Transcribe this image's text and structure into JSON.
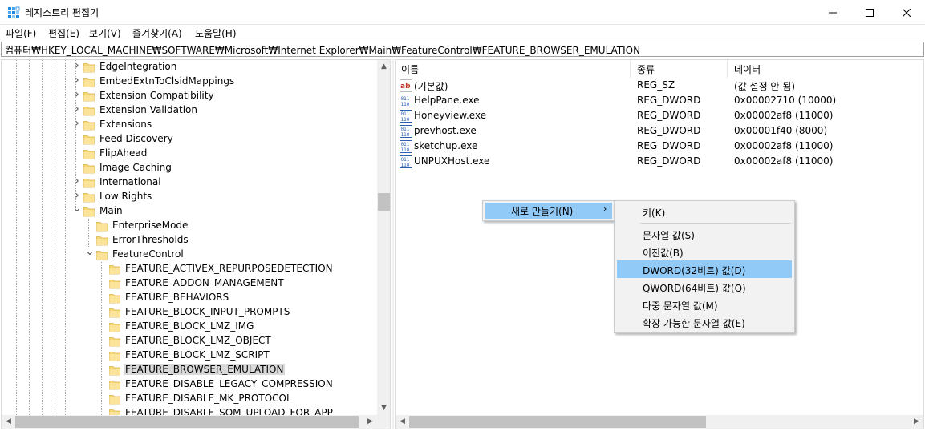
{
  "window": {
    "title": "레지스트리 편집기",
    "accent": "#1a73e8"
  },
  "menubar": {
    "items": [
      "파일(F)",
      "편집(E)",
      "보기(V)",
      "즐겨찾기(A)",
      "도움말(H)"
    ]
  },
  "address": "컴퓨터₩HKEY_LOCAL_MACHINE₩SOFTWARE₩Microsoft₩Internet Explorer₩Main₩FeatureControl₩FEATURE_BROWSER_EMULATION",
  "tree": {
    "items": [
      {
        "label": "EdgeIntegration",
        "expander": "collapsed"
      },
      {
        "label": "EmbedExtnToClsidMappings",
        "expander": "collapsed"
      },
      {
        "label": "Extension Compatibility",
        "expander": "collapsed"
      },
      {
        "label": "Extension Validation",
        "expander": "collapsed"
      },
      {
        "label": "Extensions",
        "expander": "collapsed"
      },
      {
        "label": "Feed Discovery",
        "expander": "none"
      },
      {
        "label": "FlipAhead",
        "expander": "none"
      },
      {
        "label": "Image Caching",
        "expander": "none"
      },
      {
        "label": "International",
        "expander": "collapsed"
      },
      {
        "label": "Low Rights",
        "expander": "collapsed"
      },
      {
        "label": "Main",
        "expander": "expanded"
      },
      {
        "label": "EnterpriseMode",
        "expander": "none"
      },
      {
        "label": "ErrorThresholds",
        "expander": "none"
      },
      {
        "label": "FeatureControl",
        "expander": "expanded"
      },
      {
        "label": "FEATURE_ACTIVEX_REPURPOSEDETECTION",
        "expander": "none"
      },
      {
        "label": "FEATURE_ADDON_MANAGEMENT",
        "expander": "none"
      },
      {
        "label": "FEATURE_BEHAVIORS",
        "expander": "none"
      },
      {
        "label": "FEATURE_BLOCK_INPUT_PROMPTS",
        "expander": "none"
      },
      {
        "label": "FEATURE_BLOCK_LMZ_IMG",
        "expander": "none"
      },
      {
        "label": "FEATURE_BLOCK_LMZ_OBJECT",
        "expander": "none"
      },
      {
        "label": "FEATURE_BLOCK_LMZ_SCRIPT",
        "expander": "none"
      },
      {
        "label": "FEATURE_BROWSER_EMULATION",
        "expander": "none",
        "selected": true
      },
      {
        "label": "FEATURE_DISABLE_LEGACY_COMPRESSION",
        "expander": "none"
      },
      {
        "label": "FEATURE_DISABLE_MK_PROTOCOL",
        "expander": "none"
      },
      {
        "label": "FEATURE_DISABLE_SQM_UPLOAD_FOR_APP",
        "expander": "none"
      }
    ]
  },
  "list": {
    "columns": [
      "이름",
      "종류",
      "데이터"
    ],
    "rows": [
      {
        "icon": "string-value-icon",
        "name": "(기본값)",
        "type": "REG_SZ",
        "data": "(값 설정 안 됨)"
      },
      {
        "icon": "binary-value-icon",
        "name": "HelpPane.exe",
        "type": "REG_DWORD",
        "data": "0x00002710 (10000)"
      },
      {
        "icon": "binary-value-icon",
        "name": "Honeyview.exe",
        "type": "REG_DWORD",
        "data": "0x00002af8 (11000)"
      },
      {
        "icon": "binary-value-icon",
        "name": "prevhost.exe",
        "type": "REG_DWORD",
        "data": "0x00001f40 (8000)"
      },
      {
        "icon": "binary-value-icon",
        "name": "sketchup.exe",
        "type": "REG_DWORD",
        "data": "0x00002af8 (11000)"
      },
      {
        "icon": "binary-value-icon",
        "name": "UNPUXHost.exe",
        "type": "REG_DWORD",
        "data": "0x00002af8 (11000)"
      }
    ]
  },
  "context_menu": {
    "main_item": "새로 만들기(N)",
    "submenu": [
      "키(K)",
      "문자열 값(S)",
      "이진값(B)",
      "DWORD(32비트) 값(D)",
      "QWORD(64비트) 값(Q)",
      "다중 문자열 값(M)",
      "확장 가능한 문자열 값(E)"
    ],
    "highlighted": "DWORD(32비트) 값(D)",
    "highlight_color": "#91c9f7"
  }
}
